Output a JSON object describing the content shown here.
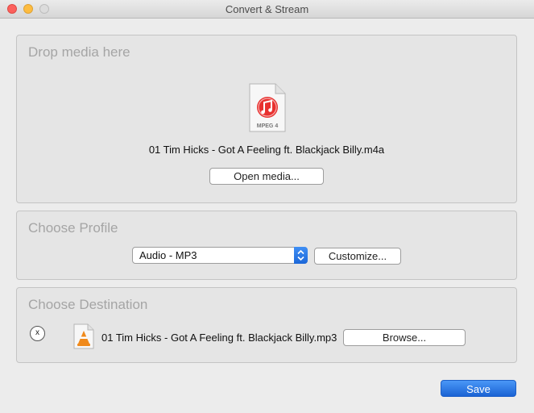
{
  "window": {
    "title": "Convert & Stream"
  },
  "source": {
    "heading": "Drop media here",
    "file_icon_label": "MPEG 4",
    "file_name": "01 Tim Hicks - Got A Feeling ft. Blackjack Billy.m4a",
    "open_button": "Open media..."
  },
  "profile": {
    "heading": "Choose Profile",
    "selected": "Audio - MP3",
    "customize_button": "Customize..."
  },
  "destination": {
    "heading": "Choose Destination",
    "clear_glyph": "x",
    "file_name": "01 Tim Hicks - Got A Feeling ft. Blackjack Billy.mp3",
    "browse_button": "Browse..."
  },
  "footer": {
    "save_button": "Save"
  },
  "colors": {
    "accent": "#1c67d8",
    "itunes_red": "#e8312f",
    "vlc_orange": "#f08a1c"
  }
}
